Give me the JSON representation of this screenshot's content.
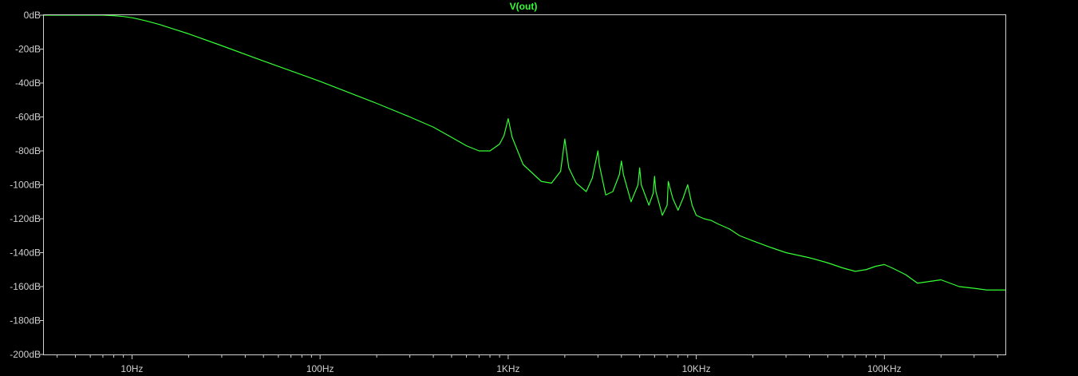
{
  "chart_data": {
    "type": "line",
    "title": "V(out)",
    "xscale": "log",
    "xlim": [
      3.4,
      440000
    ],
    "ylim": [
      -200,
      0
    ],
    "grid": false,
    "x_tick_labels": [
      {
        "value": 10,
        "label": "10Hz"
      },
      {
        "value": 100,
        "label": "100Hz"
      },
      {
        "value": 1000,
        "label": "1KHz"
      },
      {
        "value": 10000,
        "label": "10KHz"
      },
      {
        "value": 100000,
        "label": "100KHz"
      }
    ],
    "y_tick_labels": [
      {
        "value": 0,
        "label": "0dB"
      },
      {
        "value": -20,
        "label": "-20dB"
      },
      {
        "value": -40,
        "label": "-40dB"
      },
      {
        "value": -60,
        "label": "-60dB"
      },
      {
        "value": -80,
        "label": "-80dB"
      },
      {
        "value": -100,
        "label": "-100dB"
      },
      {
        "value": -120,
        "label": "-120dB"
      },
      {
        "value": -140,
        "label": "-140dB"
      },
      {
        "value": -160,
        "label": "-160dB"
      },
      {
        "value": -180,
        "label": "-180dB"
      },
      {
        "value": -200,
        "label": "-200dB"
      }
    ],
    "series": [
      {
        "name": "V(out)",
        "color": "#33ff33",
        "x": [
          3.4,
          5,
          7,
          8,
          9,
          10,
          11,
          12,
          14,
          17,
          20,
          30,
          50,
          100,
          200,
          300,
          400,
          500,
          600,
          700,
          800,
          900,
          950,
          1000,
          1050,
          1200,
          1500,
          1700,
          1900,
          2000,
          2100,
          2300,
          2600,
          2800,
          2950,
          3000,
          3050,
          3300,
          3600,
          3900,
          4000,
          4100,
          4500,
          4900,
          5000,
          5100,
          5600,
          5900,
          6000,
          6100,
          6600,
          7000,
          7100,
          7500,
          8000,
          8500,
          9000,
          9500,
          10000,
          11000,
          12000,
          13000,
          15000,
          17000,
          20000,
          25000,
          30000,
          40000,
          50000,
          60000,
          70000,
          80000,
          90000,
          100000,
          110000,
          130000,
          150000,
          200000,
          250000,
          300000,
          350000,
          440000
        ],
        "y": [
          0,
          0,
          0,
          -0.3,
          -0.8,
          -1.5,
          -2.5,
          -3.5,
          -5.5,
          -8.5,
          -11,
          -18,
          -27,
          -39,
          -52,
          -60,
          -66,
          -72,
          -77,
          -80,
          -80,
          -76,
          -71,
          -61,
          -72,
          -88,
          -98,
          -99,
          -92,
          -73,
          -90,
          -99,
          -104,
          -96,
          -84,
          -80,
          -88,
          -106,
          -104,
          -94,
          -86,
          -94,
          -110,
          -100,
          -90,
          -100,
          -112,
          -105,
          -95,
          -104,
          -118,
          -112,
          -98,
          -108,
          -115,
          -108,
          -100,
          -112,
          -118,
          -120,
          -121,
          -123,
          -126,
          -130,
          -133,
          -137,
          -140,
          -143,
          -146,
          -149,
          -151,
          -150,
          -148,
          -147,
          -149,
          -153,
          -158,
          -156,
          -160,
          -161,
          -162,
          -162
        ]
      }
    ]
  }
}
